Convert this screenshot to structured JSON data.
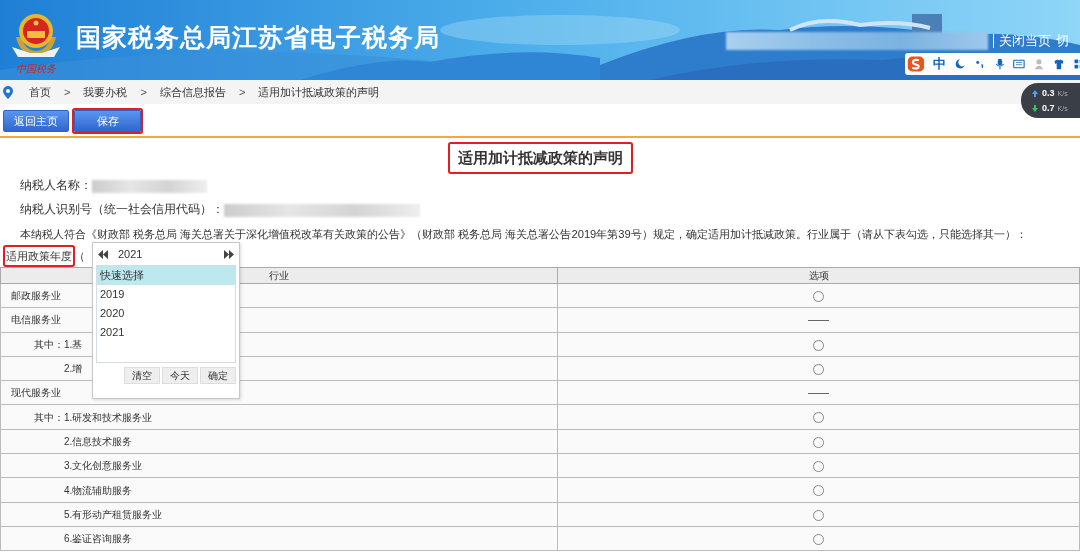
{
  "header": {
    "title": "国家税务总局江苏省电子税务局",
    "emblem_caption": "中国税务",
    "links": [
      "关闭当页",
      "切"
    ]
  },
  "ime_toolbar": {
    "mode": "中"
  },
  "net_speed": [
    {
      "kind": "upload",
      "value": "0.3",
      "unit": "K/s"
    },
    {
      "kind": "download",
      "value": "0.7",
      "unit": "K/s"
    }
  ],
  "breadcrumb": {
    "separator": ">",
    "items": [
      "首页",
      "我要办税",
      "综合信息报告",
      "适用加计抵减政策的声明"
    ]
  },
  "buttons": [
    {
      "label": "返回主页",
      "highlighted": false
    },
    {
      "label": "保存",
      "highlighted": true
    }
  ],
  "form": {
    "title": "适用加计抵减政策的声明",
    "title_highlighted": true,
    "fields": [
      {
        "label": "纳税人名称："
      },
      {
        "label": "纳税人识别号（统一社会信用代码）："
      }
    ],
    "statement": "本纳税人符合《财政部 税务总局 海关总署关于深化增值税改革有关政策的公告》（财政部 税务总局 海关总署公告2019年第39号）规定，确定适用加计抵减政策。行业属于（请从下表勾选，只能选择其一）：",
    "year_label": "适用政策年度",
    "year_label_highlighted": true,
    "year_paren": "（"
  },
  "date_picker": {
    "year": "2021",
    "options": [
      {
        "label": "快速选择",
        "selected": true
      },
      {
        "label": "2019",
        "selected": false
      },
      {
        "label": "2020",
        "selected": false
      },
      {
        "label": "2021",
        "selected": false
      }
    ],
    "buttons": [
      "清空",
      "今天",
      "确定"
    ]
  },
  "table": {
    "columns": [
      "行业",
      "选项"
    ],
    "rows": [
      {
        "label": "邮政服务业",
        "kind": "category",
        "selectable": true,
        "selected": false
      },
      {
        "label": "电信服务业",
        "kind": "category",
        "selectable": false
      },
      {
        "label": "其中：1.基",
        "kind": "first_item",
        "selectable": true,
        "selected": false
      },
      {
        "label": "2.增",
        "kind": "item",
        "selectable": true,
        "selected": false
      },
      {
        "label": "现代服务业",
        "kind": "category",
        "selectable": false
      },
      {
        "label": "其中：1.研发和技术服务业",
        "kind": "first_item",
        "selectable": true,
        "selected": false
      },
      {
        "label": "2.信息技术服务",
        "kind": "item",
        "selectable": true,
        "selected": false
      },
      {
        "label": "3.文化创意服务业",
        "kind": "item",
        "selectable": true,
        "selected": false
      },
      {
        "label": "4.物流辅助服务",
        "kind": "item",
        "selectable": true,
        "selected": false
      },
      {
        "label": "5.有形动产租赁服务业",
        "kind": "item",
        "selectable": true,
        "selected": false
      },
      {
        "label": "6.鉴证咨询服务",
        "kind": "item",
        "selectable": true,
        "selected": false
      }
    ]
  }
}
